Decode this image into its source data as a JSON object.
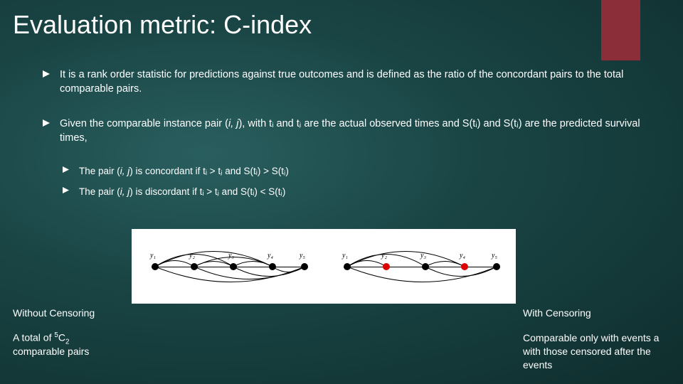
{
  "title": "Evaluation metric: C-index",
  "bullets": {
    "b1": "It is a rank order statistic for predictions against true outcomes and is defined as the ratio of the concordant pairs to the total comparable pairs.",
    "b2a": "Given the comparable instance pair (",
    "b2_ij": "i, j",
    "b2b": "), with tᵢ and tⱼ are the actual observed times and S(tᵢ) and S(tⱼ) are the predicted survival times,",
    "s1a": "The pair (",
    "s1b": ") is concordant if  tᵢ > tⱼ and S(tᵢ) > S(tⱼ)",
    "s2a": "The pair (",
    "s2b": ") is discordant if  tᵢ > tⱼ and S(tᵢ) < S(tⱼ)"
  },
  "diagram": {
    "left_labels": [
      "y₁",
      "y₂",
      "y₃",
      "y₄",
      "y₅"
    ],
    "right_labels": [
      "y₁",
      "y₂",
      "y₃",
      "y₄",
      "y₅"
    ]
  },
  "left_box": {
    "heading": "Without Censoring",
    "line1a": "A total of ",
    "line1b": "C",
    "line2": "comparable pairs"
  },
  "right_box": {
    "heading": "With Censoring",
    "line1": "Comparable only with events a",
    "line2": "with those censored after the",
    "line3": "events"
  }
}
